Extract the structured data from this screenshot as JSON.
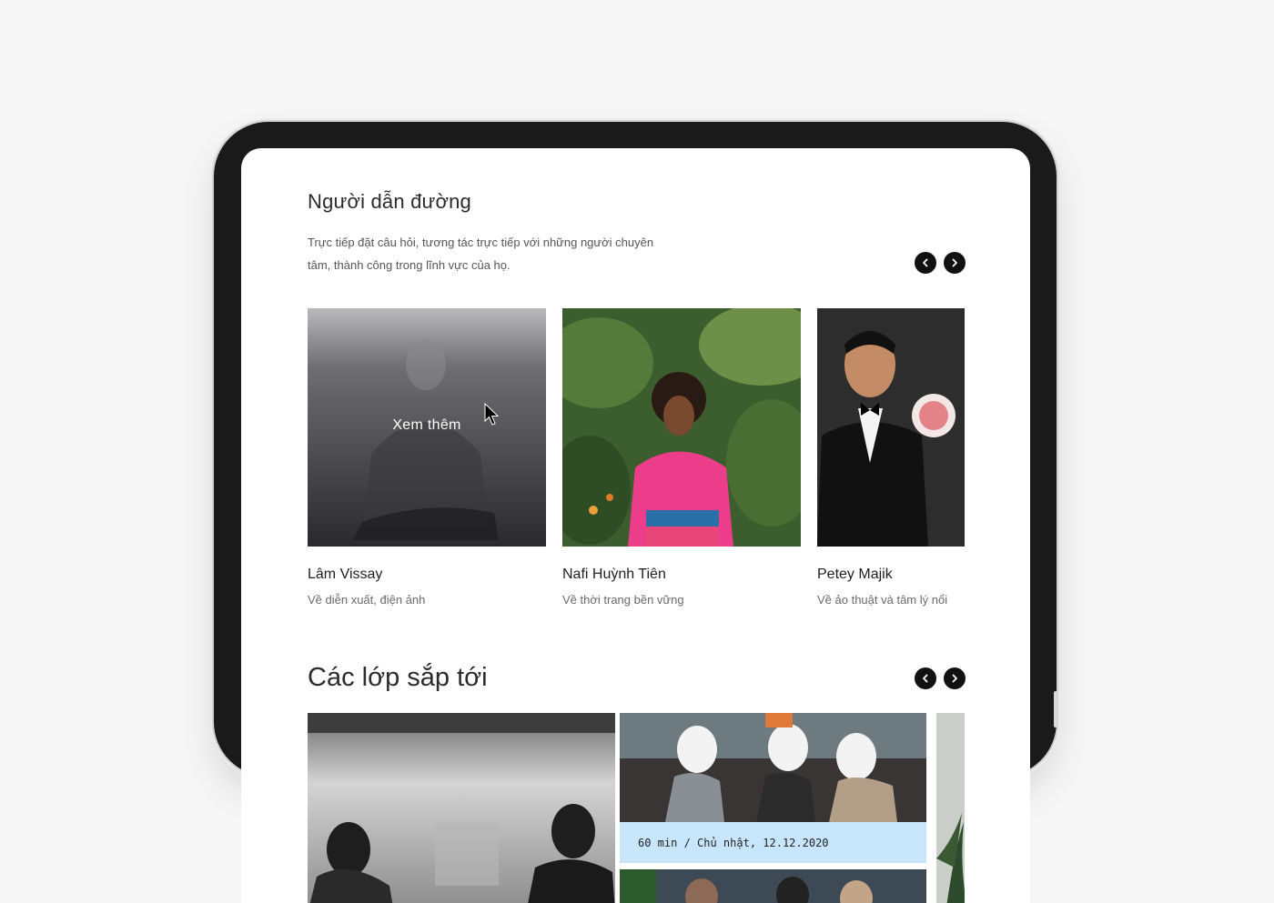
{
  "mentors_section": {
    "title": "Người dẫn đường",
    "description": "Trực tiếp đặt câu hỏi, tương tác trực tiếp với những người chuyên tâm, thành công trong lĩnh vực của họ.",
    "prev_icon": "chevron-left-icon",
    "next_icon": "chevron-right-icon",
    "hover_label": "Xem thêm",
    "mentors": [
      {
        "name": "Lâm Vissay",
        "topic": "Về diễn xuất, điện ảnh"
      },
      {
        "name": "Nafi Huỳnh Tiên",
        "topic": "Về thời trang bền vững"
      },
      {
        "name": "Petey Majik",
        "topic": "Về ảo thuật và tâm lý nổi"
      }
    ]
  },
  "classes_section": {
    "title": "Các lớp sắp tới",
    "prev_icon": "chevron-left-icon",
    "next_icon": "chevron-right-icon",
    "class_info": "60 min / Chủ nhật, 12.12.2020"
  },
  "colors": {
    "page_bg": "#f6f6f6",
    "device_frame": "#1a1a1a",
    "nav_button": "#111111",
    "class_info_bg": "#c8e6fb"
  }
}
